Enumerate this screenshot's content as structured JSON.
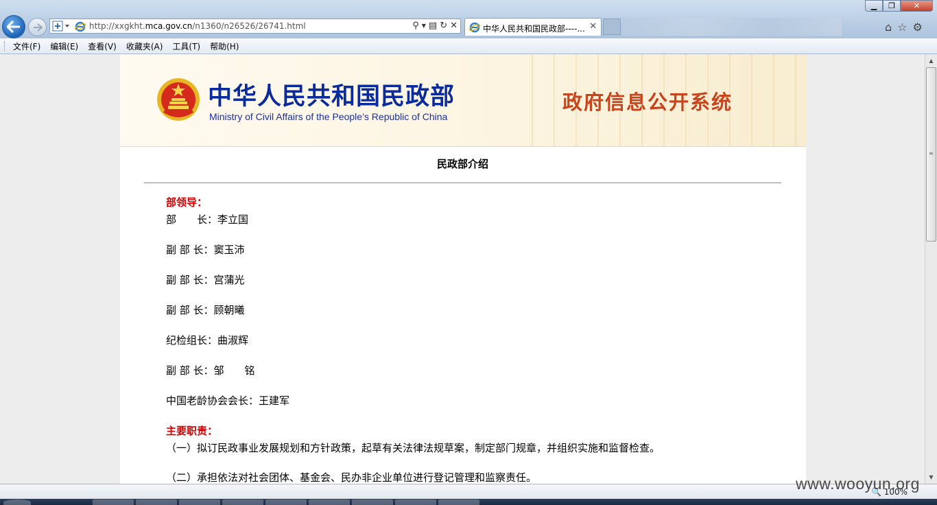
{
  "browser": {
    "url_prefix": "http://xxgkht.",
    "url_domain": "mca.gov.cn",
    "url_path": "/n1360/n26526/26741.html",
    "tab_title": "中华人民共和国民政部----...",
    "zoom": "100%",
    "menu": [
      "文件(F)",
      "编辑(E)",
      "查看(V)",
      "收藏夹(A)",
      "工具(T)",
      "帮助(H)"
    ]
  },
  "header": {
    "org_cn": "中华人民共和国民政部",
    "org_en": "Ministry of Civil Affairs of the People’s Republic  of China",
    "system_name": "政府信息公开系统"
  },
  "article": {
    "title": "民政部介绍",
    "leaders_heading": "部领导：",
    "leaders": [
      "部　　长：李立国",
      "副 部 长：窦玉沛",
      "副 部 长：宫蒲光",
      "副 部 长：顾朝曦",
      "纪检组长：曲淑辉",
      "副 部 长：邹　　铭",
      "中国老龄协会会长：王建军"
    ],
    "duties_heading": "主要职责：",
    "duties": [
      "（一）拟订民政事业发展规划和方针政策，起草有关法律法规草案，制定部门规章，并组织实施和监督检查。",
      "（二）承担依法对社会团体、基金会、民办非企业单位进行登记管理和监察责任。"
    ]
  },
  "watermark": "www.wooyun.org",
  "colors": {
    "section_heading": "#d40000",
    "org_name": "#0a2b9c",
    "system_name": "#c8441c"
  }
}
